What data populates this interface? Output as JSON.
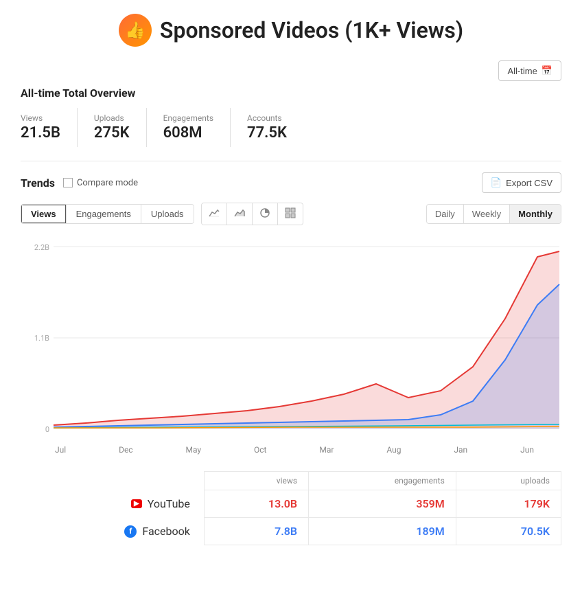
{
  "header": {
    "title": "Sponsored Videos (1K+ Views)",
    "icon": "👍"
  },
  "topControls": {
    "allTimeBtn": "All-time",
    "calendarIcon": "📅"
  },
  "overview": {
    "title": "All-time Total Overview",
    "stats": [
      {
        "label": "Views",
        "value": "21.5B"
      },
      {
        "label": "Uploads",
        "value": "275K"
      },
      {
        "label": "Engagements",
        "value": "608M"
      },
      {
        "label": "Accounts",
        "value": "77.5K"
      }
    ]
  },
  "trends": {
    "title": "Trends",
    "compareModeLabel": "Compare mode",
    "exportBtn": "Export CSV",
    "tabs": [
      {
        "label": "Views",
        "active": true
      },
      {
        "label": "Engagements",
        "active": false
      },
      {
        "label": "Uploads",
        "active": false
      }
    ],
    "chartIcons": [
      "~",
      "≈",
      "◉",
      "⊞"
    ],
    "periods": [
      {
        "label": "Daily",
        "active": false
      },
      {
        "label": "Weekly",
        "active": false
      },
      {
        "label": "Monthly",
        "active": true
      }
    ],
    "chart": {
      "yLabels": [
        "2.2B",
        "1.1B",
        "0"
      ],
      "xLabels": [
        "Jul",
        "Dec",
        "May",
        "Oct",
        "Mar",
        "Aug",
        "Jan",
        "Jun"
      ]
    }
  },
  "dataTable": {
    "headers": [
      "",
      "views",
      "engagements",
      "uploads"
    ],
    "rows": [
      {
        "platform": "YouTube",
        "platformType": "youtube",
        "views": "13.0B",
        "engagements": "359M",
        "uploads": "179K"
      },
      {
        "platform": "Facebook",
        "platformType": "facebook",
        "views": "7.8B",
        "engagements": "189M",
        "uploads": "70.5K"
      }
    ]
  }
}
